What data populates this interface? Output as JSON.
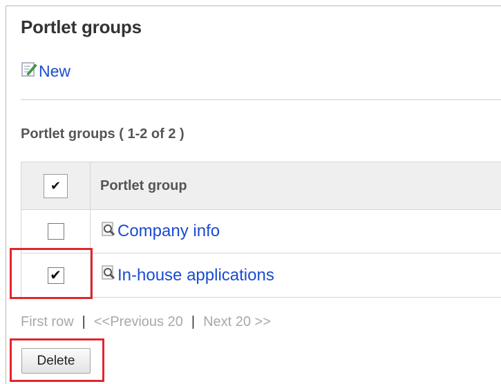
{
  "page": {
    "title": "Portlet groups",
    "new_label": "New"
  },
  "list": {
    "heading": "Portlet groups ( 1-2 of 2 )",
    "column_header": "Portlet group",
    "select_all_checked": true,
    "rows": [
      {
        "name": "Company info",
        "checked": false
      },
      {
        "name": "In-house applications",
        "checked": true
      }
    ]
  },
  "pager": {
    "first": "First row",
    "separator": "|",
    "previous": "<<Previous 20",
    "next": "Next 20 >>"
  },
  "actions": {
    "delete_label": "Delete"
  },
  "icons": {
    "new": "edit-pencil-icon",
    "item": "magnifier-page-icon"
  },
  "colors": {
    "link": "#1a4bd1",
    "highlight": "#e0262c",
    "header_bg": "#efefef",
    "disabled_text": "#a8a8a8"
  }
}
